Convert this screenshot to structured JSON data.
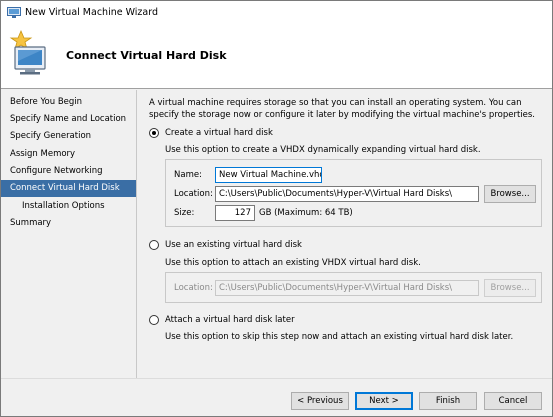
{
  "window": {
    "title": "New Virtual Machine Wizard"
  },
  "header": {
    "title": "Connect Virtual Hard Disk"
  },
  "sidebar": {
    "items": [
      {
        "label": "Before You Begin"
      },
      {
        "label": "Specify Name and Location"
      },
      {
        "label": "Specify Generation"
      },
      {
        "label": "Assign Memory"
      },
      {
        "label": "Configure Networking"
      },
      {
        "label": "Connect Virtual Hard Disk"
      },
      {
        "label": "Installation Options"
      },
      {
        "label": "Summary"
      }
    ]
  },
  "content": {
    "intro": "A virtual machine requires storage so that you can install an operating system. You can specify the storage now or configure it later by modifying the virtual machine's properties.",
    "create": {
      "label": "Create a virtual hard disk",
      "description": "Use this option to create a VHDX dynamically expanding virtual hard disk.",
      "name_label": "Name:",
      "name_value": "New Virtual Machine.vhdx",
      "location_label": "Location:",
      "location_value": "C:\\Users\\Public\\Documents\\Hyper-V\\Virtual Hard Disks\\",
      "browse_label": "Browse...",
      "size_label": "Size:",
      "size_value": "127",
      "size_suffix": "GB (Maximum: 64 TB)"
    },
    "existing": {
      "label": "Use an existing virtual hard disk",
      "description": "Use this option to attach an existing VHDX virtual hard disk.",
      "location_label": "Location:",
      "location_value": "C:\\Users\\Public\\Documents\\Hyper-V\\Virtual Hard Disks\\",
      "browse_label": "Browse..."
    },
    "later": {
      "label": "Attach a virtual hard disk later",
      "description": "Use this option to skip this step now and attach an existing virtual hard disk later."
    }
  },
  "footer": {
    "previous": "< Previous",
    "next": "Next >",
    "finish": "Finish",
    "cancel": "Cancel"
  },
  "colors": {
    "accent": "#3a6ea5",
    "focus": "#0078d7"
  }
}
